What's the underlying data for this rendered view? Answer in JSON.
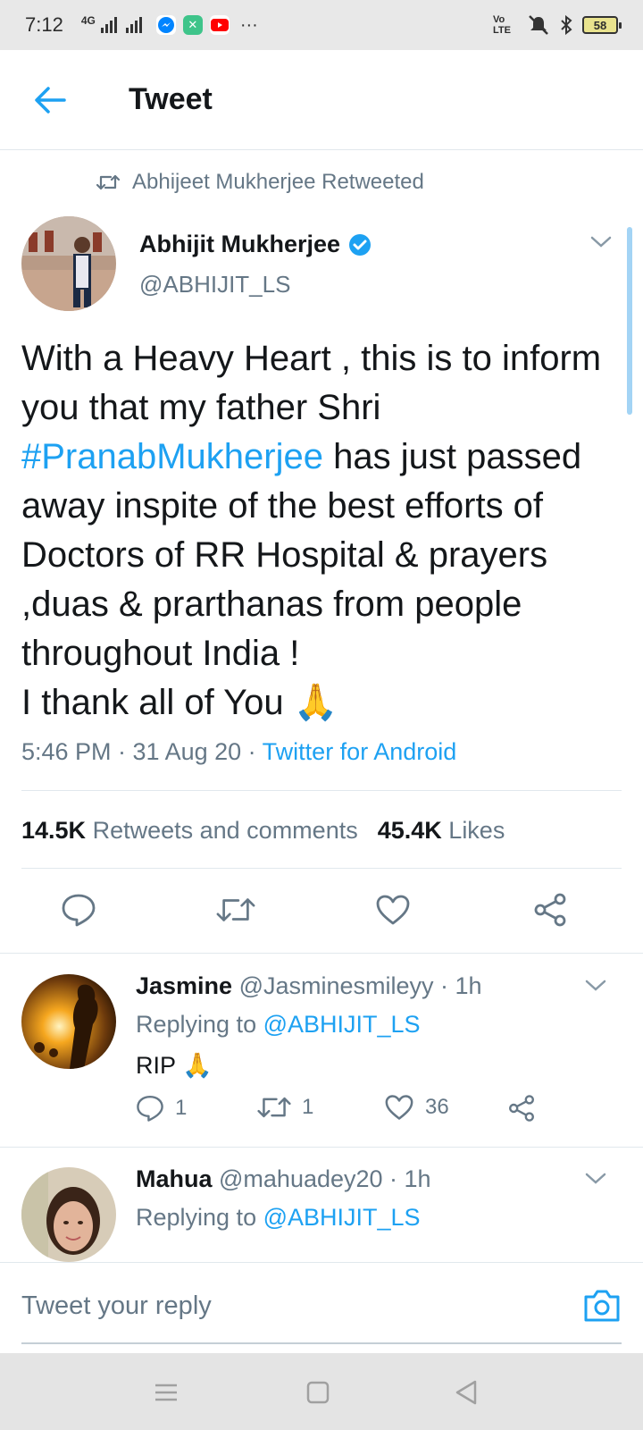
{
  "status_bar": {
    "time": "7:12",
    "network": "4G",
    "volte": "Vo LTE",
    "battery": "58",
    "more": "···"
  },
  "header": {
    "title": "Tweet"
  },
  "tweet": {
    "retweeted_by": "Abhijeet Mukherjee Retweeted",
    "author_name": "Abhijit Mukherjee",
    "author_handle": "@ABHIJIT_LS",
    "text_line1": "With a Heavy Heart , this is to inform you that my father Shri ",
    "hashtag": "#PranabMukherjee",
    "text_line2": " has just passed away inspite of the best efforts of Doctors of RR Hospital & prayers ,duas & prarthanas from people throughout India !",
    "text_line3": "I thank all of You 🙏",
    "timestamp": "5:46 PM · 31 Aug 20 · ",
    "source": "Twitter for Android",
    "retweets_count": "14.5K",
    "retweets_label": "Retweets and comments",
    "likes_count": "45.4K",
    "likes_label": "Likes"
  },
  "replies": [
    {
      "name": "Jasmine",
      "handle_time": " @Jasminesmileyy · 1h",
      "replying_prefix": "Replying to ",
      "replying_to": "@ABHIJIT_LS",
      "text": "RIP 🙏",
      "comments": "1",
      "retweets": "1",
      "likes": "36"
    },
    {
      "name": "Mahua",
      "handle_time": " @mahuadey20 · 1h",
      "replying_prefix": "Replying to ",
      "replying_to": "@ABHIJIT_LS"
    }
  ],
  "composer": {
    "placeholder": "Tweet your reply"
  },
  "colors": {
    "accent": "#1da1f2",
    "secondary_text": "#657786",
    "primary_text": "#14171a"
  }
}
